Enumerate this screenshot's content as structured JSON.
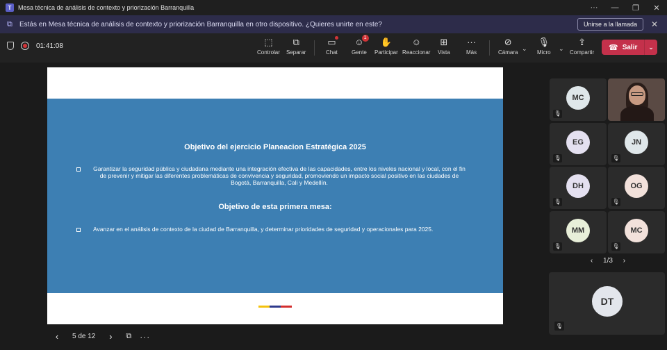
{
  "window": {
    "title": "Mesa técnica de análisis de contexto y priorización Barranquilla"
  },
  "banner": {
    "text": "Estás en Mesa técnica de análisis de contexto y priorización Barranquilla en otro dispositivo. ¿Quieres unirte en este?",
    "join_label": "Unirse a la llamada"
  },
  "toolbar": {
    "timer": "01:41:08",
    "items": [
      {
        "label": "Controlar",
        "icon": "control-icon"
      },
      {
        "label": "Separar",
        "icon": "popout-icon"
      },
      {
        "label": "Chat",
        "icon": "chat-icon"
      },
      {
        "label": "Gente",
        "icon": "people-icon",
        "badge": "1"
      },
      {
        "label": "Participar",
        "icon": "raise-hand-icon"
      },
      {
        "label": "Reaccionar",
        "icon": "react-icon"
      },
      {
        "label": "Vista",
        "icon": "view-icon"
      },
      {
        "label": "Más",
        "icon": "more-icon"
      },
      {
        "label": "Cámara",
        "icon": "camera-off-icon"
      },
      {
        "label": "Micro",
        "icon": "mic-off-icon"
      },
      {
        "label": "Compartir",
        "icon": "share-icon"
      }
    ],
    "leave_label": "Salir",
    "leave_color": "#c4314b"
  },
  "slide": {
    "title1": "Objetivo del ejercicio Planeacion Estratégica 2025",
    "bullet1": "Garantizar la seguridad pública y ciudadana mediante una integración efectiva de las capacidades, entre los niveles nacional y local, con el fin de prevenir y mitigar las diferentes problemáticas de convivencia y seguridad, promoviendo un impacto social positivo en las ciudades de Bogotá, Barranquilla, Cali y Medellín.",
    "title2": "Objetivo de esta primera mesa:",
    "bullet2": "Avanzar en el análisis de contexto de la ciudad de Barranquilla, y determinar prioridades de seguridad y operacionales para 2025.",
    "band_color": "#3d7fb3",
    "flag_colors": [
      "#f4c20d",
      "#2e3a8c",
      "#d32f2f"
    ]
  },
  "slide_nav": {
    "page": "5 de 12"
  },
  "participants": {
    "tiles": [
      {
        "initials": "MC",
        "color": "#dfe7ea"
      },
      {
        "initials": "",
        "video": true
      },
      {
        "initials": "EG",
        "color": "#e4e0f0"
      },
      {
        "initials": "JN",
        "color": "#dfe7ea"
      },
      {
        "initials": "DH",
        "color": "#e4e0f0"
      },
      {
        "initials": "OG",
        "color": "#f2e1db"
      },
      {
        "initials": "MM",
        "color": "#e8efd9"
      },
      {
        "initials": "MC",
        "color": "#f2e1db"
      }
    ],
    "pager": "1/3",
    "featured": {
      "initials": "DT",
      "color": "#e3e6ec"
    }
  }
}
